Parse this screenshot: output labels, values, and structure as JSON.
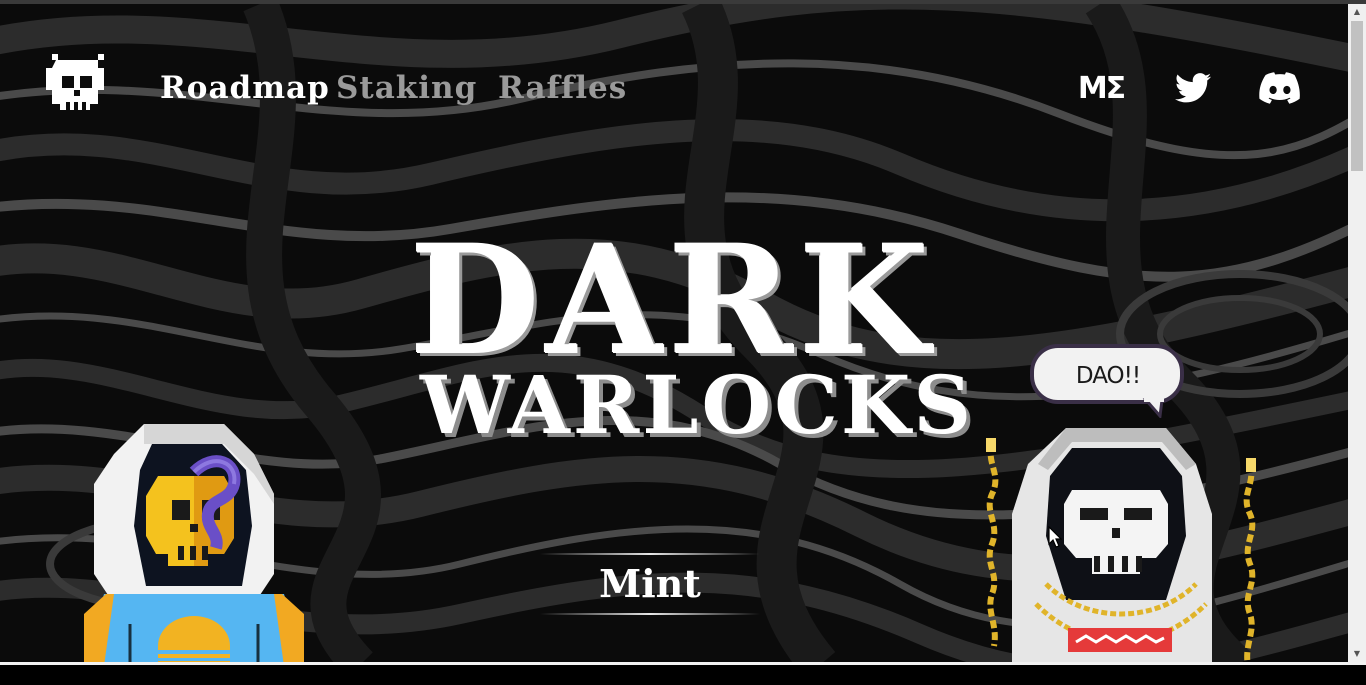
{
  "nav": {
    "links": [
      {
        "label": "Roadmap"
      },
      {
        "label": "Staking"
      },
      {
        "label": "Raffles"
      }
    ],
    "social": {
      "magic_eden_label": "MΣ",
      "twitter_icon": "twitter-icon",
      "discord_icon": "discord-icon"
    }
  },
  "hero": {
    "title_line1": "DARK",
    "title_line2": "WARLOCKS",
    "mint_label": "Mint",
    "speech_bubble": "DAO!!"
  },
  "colors": {
    "background": "#0c0c0c",
    "nav_active": "#ffffff",
    "nav_inactive": "#9a9a9a",
    "left_character_face": "#f4c21e",
    "left_character_shirt": "#55b6f2",
    "right_character_robe": "#dcdcdc",
    "chain_gold": "#e0b42a",
    "purple": "#6a4fc7",
    "red_badge": "#e53a3a"
  }
}
